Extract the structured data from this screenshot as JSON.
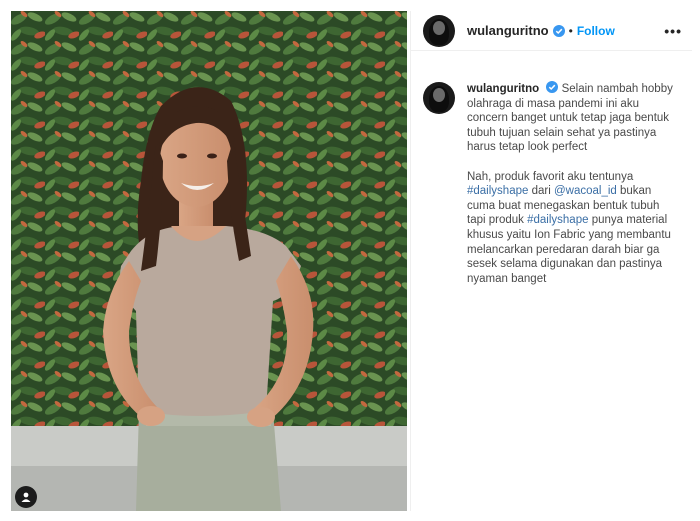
{
  "post": {
    "username": "wulanguritno",
    "follow_label": "Follow",
    "separator": "•",
    "more_label": "•••"
  },
  "caption": {
    "username": "wulanguritno",
    "p1": "Selain nambah hobby olahraga di masa pandemi ini aku concern banget untuk tetap jaga bentuk tubuh tujuan selain sehat ya pastinya harus tetap look perfect",
    "p2_a": "Nah, produk favorit aku tentunya ",
    "hashtag_1": "#dailyshape",
    "p2_b": " dari ",
    "mention": "@wacoal_id",
    "p2_c": " bukan cuma buat menegaskan bentuk tubuh tapi produk ",
    "hashtag_2": "#dailyshape",
    "p2_d": " punya material khusus yaitu Ion Fabric yang membantu melancarkan peredaran darah biar ga sesek selama digunakan dan pastinya nyaman banget"
  },
  "colors": {
    "follow": "#0095f6",
    "verified": "#3897f0",
    "link": "#3a6ea5"
  },
  "icons": {
    "verified": "verified-badge-icon",
    "tag": "user-tag-icon",
    "more": "more-options-icon"
  }
}
